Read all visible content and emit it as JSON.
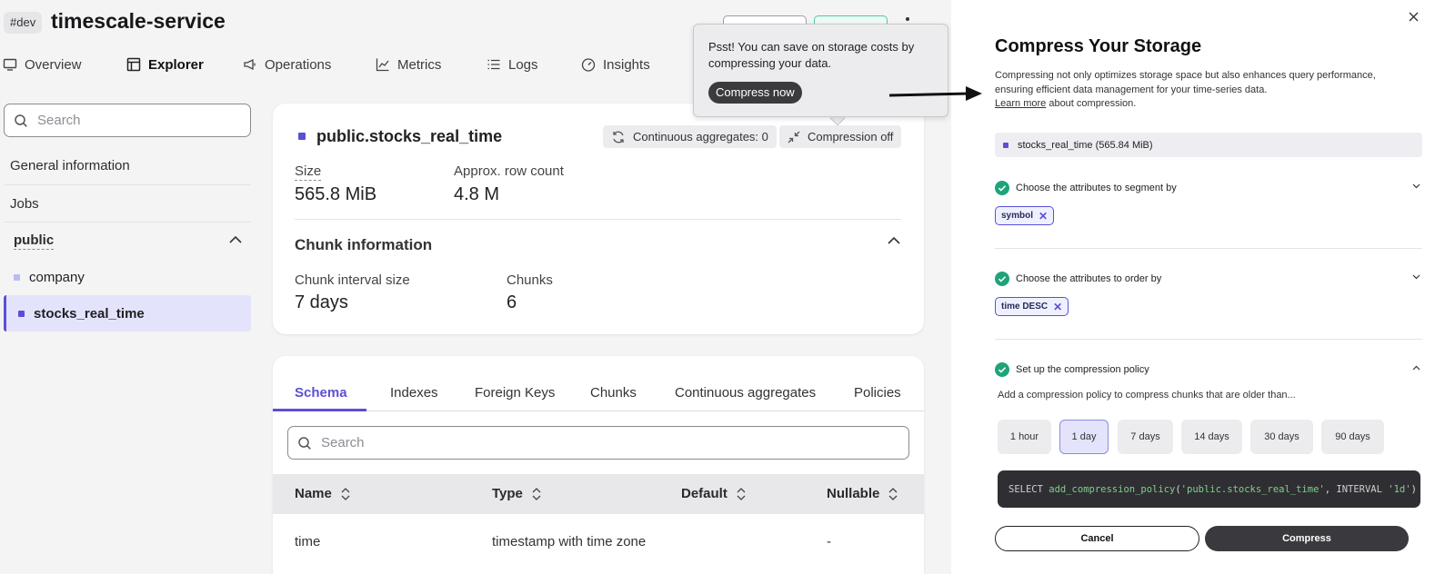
{
  "header": {
    "env_tag": "#dev",
    "service_name": "timescale-service"
  },
  "nav": {
    "items": [
      {
        "label": "Overview",
        "icon": "monitor-icon"
      },
      {
        "label": "Explorer",
        "icon": "table-icon",
        "active": true
      },
      {
        "label": "Operations",
        "icon": "megaphone-icon"
      },
      {
        "label": "Metrics",
        "icon": "line-chart-icon"
      },
      {
        "label": "Logs",
        "icon": "list-icon"
      },
      {
        "label": "Insights",
        "icon": "gauge-icon"
      }
    ]
  },
  "sidebar": {
    "search_placeholder": "Search",
    "general_information": "General information",
    "jobs": "Jobs",
    "schema_group": "public",
    "tables": [
      {
        "name": "company"
      },
      {
        "name": "stocks_real_time",
        "active": true
      }
    ]
  },
  "table_card": {
    "name": "public.stocks_real_time",
    "continuous_aggregates": "Continuous aggregates: 0",
    "compression": "Compression off",
    "size_label": "Size",
    "size_value": "565.8 MiB",
    "rows_label": "Approx. row count",
    "rows_value": "4.8 M",
    "chunk_section": "Chunk information",
    "chunk_interval_label": "Chunk interval size",
    "chunk_interval_value": "7 days",
    "chunks_label": "Chunks",
    "chunks_value": "6"
  },
  "tabs": {
    "items": [
      "Schema",
      "Indexes",
      "Foreign Keys",
      "Chunks",
      "Continuous aggregates",
      "Policies"
    ],
    "active": "Schema",
    "search_placeholder": "Search",
    "columns": [
      "Name",
      "Type",
      "Default",
      "Nullable"
    ],
    "rows": [
      {
        "name": "time",
        "type": "timestamp with time zone",
        "default": "",
        "nullable": "-"
      }
    ]
  },
  "tooltip": {
    "text": "Psst! You can save on storage costs by compressing your data.",
    "button": "Compress now"
  },
  "panel": {
    "title": "Compress Your Storage",
    "description": "Compressing not only optimizes storage space but also enhances query performance, ensuring efficient data management for your time-series data.",
    "learn_more": "Learn more",
    "learn_more_suffix": "about compression.",
    "table_chip": "stocks_real_time (565.84 MiB)",
    "step1": "Choose the attributes to segment by",
    "step1_tag": "symbol",
    "step2": "Choose the attributes to order by",
    "step2_tag": "time DESC",
    "step3": "Set up the compression policy",
    "policy_hint": "Add a compression policy to compress chunks that are older than...",
    "intervals": [
      "1 hour",
      "1 day",
      "7 days",
      "14 days",
      "30 days",
      "90 days"
    ],
    "selected_interval": "1 day",
    "sql": {
      "kw1": "SELECT",
      "fn": "add_compression_policy",
      "arg1": "'public.stocks_real_time'",
      "kw2": "INTERVAL",
      "arg2": "'1d'"
    },
    "cancel": "Cancel",
    "compress": "Compress"
  },
  "colors": {
    "accent": "#5b4fd6",
    "success": "#1fa37a",
    "dark_button": "#3a3a3e"
  }
}
